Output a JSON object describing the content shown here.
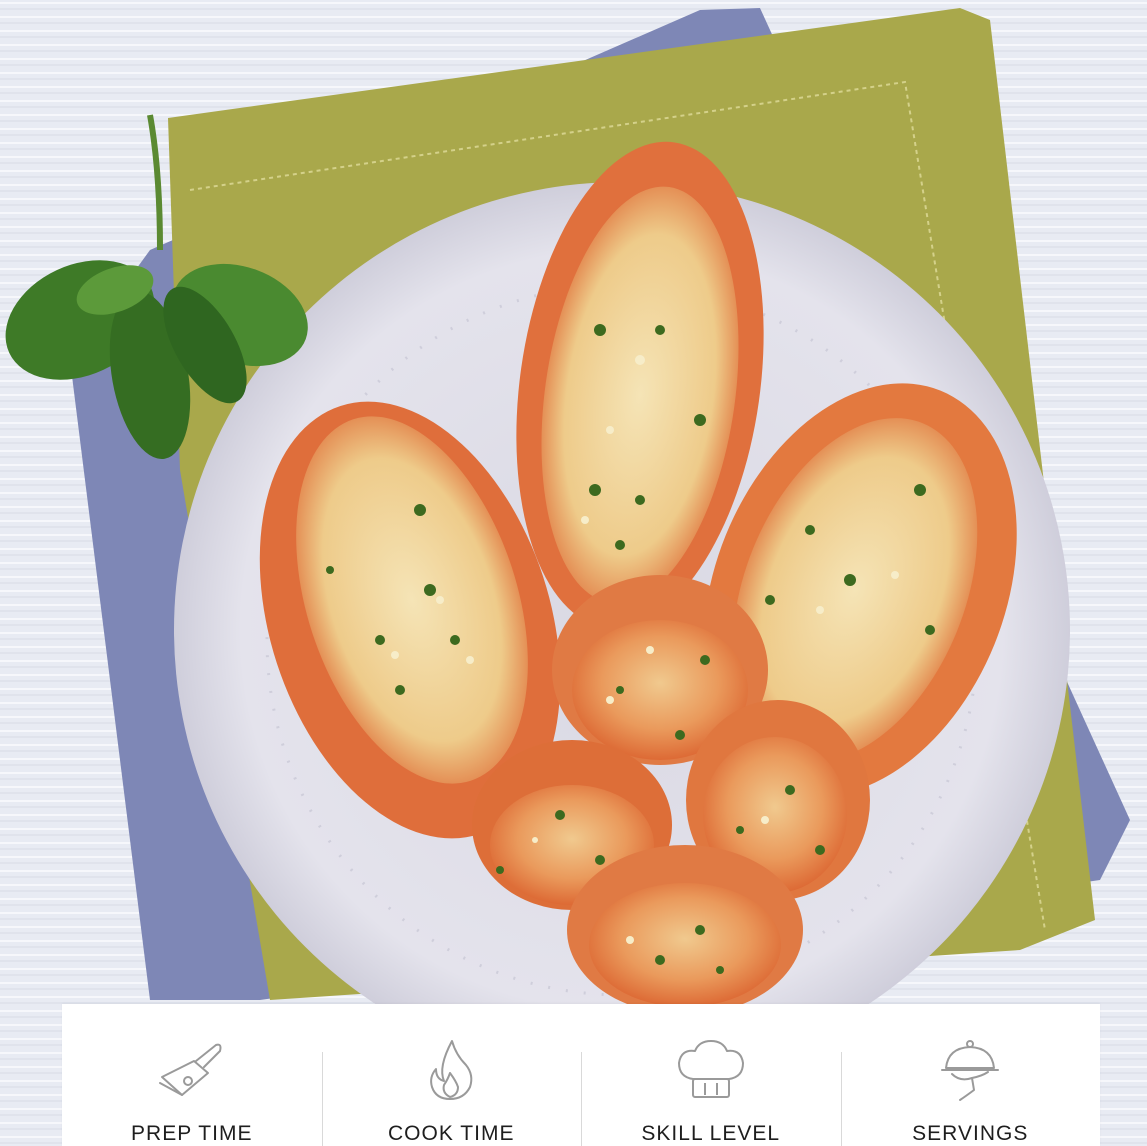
{
  "hero": {
    "image": "garlic-bread-plate-photo"
  },
  "recipe_info": {
    "items": [
      {
        "icon": "cutting-board-knife-icon",
        "label": "PREP TIME"
      },
      {
        "icon": "flame-icon",
        "label": "COOK TIME"
      },
      {
        "icon": "chef-hat-icon",
        "label": "SKILL LEVEL"
      },
      {
        "icon": "serving-cloche-icon",
        "label": "SERVINGS"
      }
    ]
  },
  "colors": {
    "background": "#e9ecf3",
    "napkin_green": "#a7a74a",
    "napkin_blue": "#7f88b8",
    "plate": "#dcdbe6",
    "bread_crust": "#e2743f",
    "bread_crumb": "#f2dca6",
    "basil": "#3f7a2a",
    "icon_stroke": "#9a9a9a",
    "label_text": "#1e1e1e"
  }
}
